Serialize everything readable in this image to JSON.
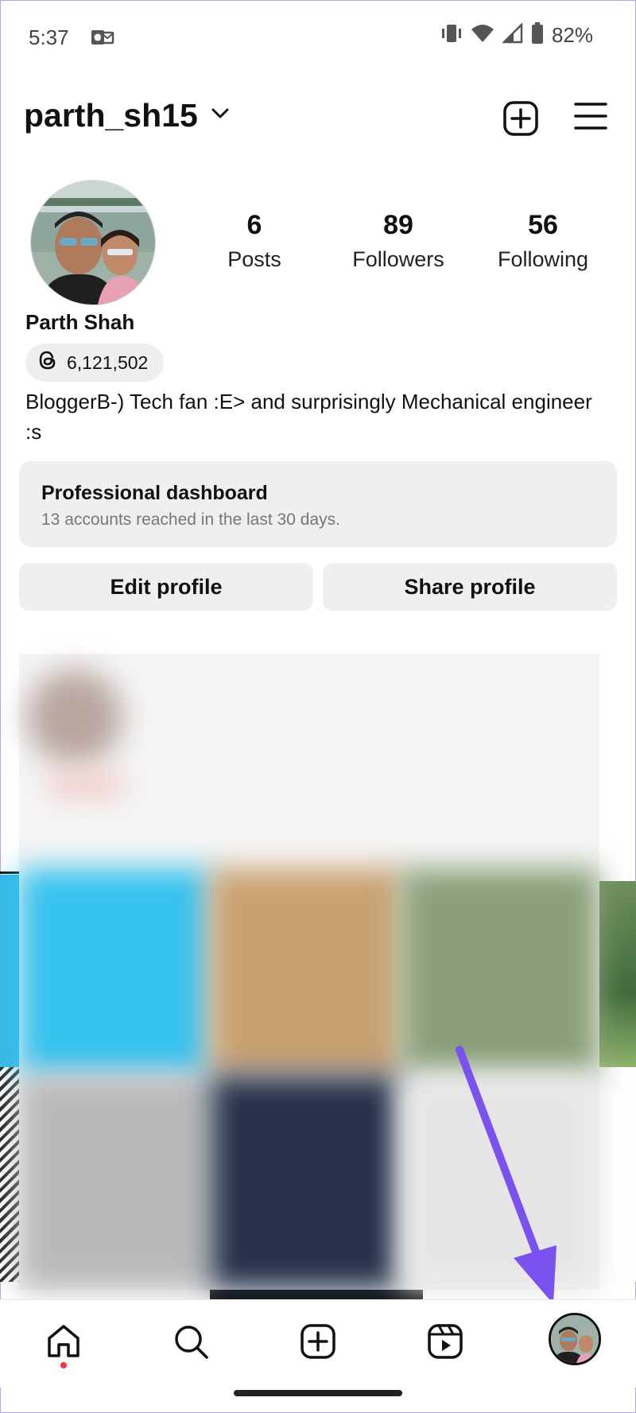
{
  "status_bar": {
    "time": "5:37",
    "battery_percent": "82%",
    "icons": [
      "outlook-icon",
      "vibrate-icon",
      "wifi-icon",
      "signal-icon",
      "battery-icon"
    ]
  },
  "header": {
    "username": "parth_sh15",
    "icons": [
      "chevron-down-icon",
      "create-post-icon",
      "menu-icon"
    ]
  },
  "profile": {
    "full_name": "Parth Shah",
    "threads_count": "6,121,502",
    "bio": "BloggerB-) Tech fan :E> and surprisingly Mechanical engineer :s",
    "stats": [
      {
        "value": "6",
        "label": "Posts"
      },
      {
        "value": "89",
        "label": "Followers"
      },
      {
        "value": "56",
        "label": "Following"
      }
    ]
  },
  "dashboard": {
    "title": "Professional dashboard",
    "subtitle": "13 accounts reached in the last 30 days."
  },
  "buttons": {
    "edit": "Edit profile",
    "share": "Share profile"
  },
  "bottom_nav": {
    "items": [
      "home-icon",
      "search-icon",
      "create-icon",
      "reels-icon",
      "profile-avatar"
    ],
    "active": "profile-avatar"
  },
  "colors": {
    "arrow": "#7b52f0",
    "notification_dot": "#ff3040",
    "button_bg": "#efefef"
  }
}
